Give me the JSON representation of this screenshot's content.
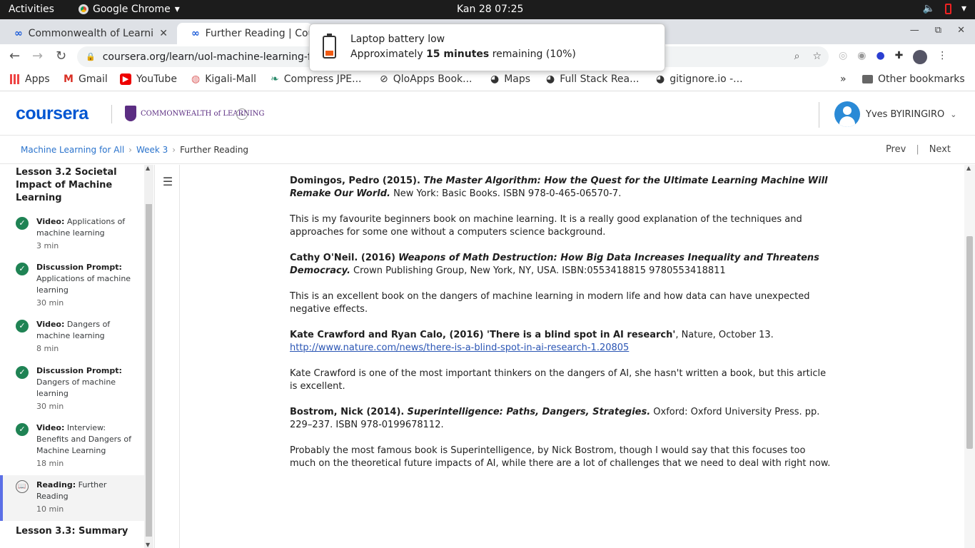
{
  "system": {
    "activities": "Activities",
    "app_name": "Google Chrome",
    "clock": "Kan 28  07:25"
  },
  "tabs": [
    {
      "title": "Commonwealth of Learni"
    },
    {
      "title": "Further Reading | Cou"
    }
  ],
  "address": {
    "url": "coursera.org/learn/uol-machine-learning-for-al"
  },
  "bookmarks": [
    {
      "label": "Apps"
    },
    {
      "label": "Gmail"
    },
    {
      "label": "YouTube"
    },
    {
      "label": "Kigali-Mall"
    },
    {
      "label": "Compress JPE..."
    },
    {
      "label": "QloApps Book..."
    },
    {
      "label": "Maps"
    },
    {
      "label": "Full Stack Rea..."
    },
    {
      "label": "gitignore.io -..."
    },
    {
      "label": "»"
    },
    {
      "label": "Other bookmarks"
    }
  ],
  "notification": {
    "title": "Laptop battery low",
    "prefix": "Approximately ",
    "bold": "15 minutes",
    "suffix": " remaining (10%)",
    "battery_level": 0.1
  },
  "header": {
    "logo": "coursera",
    "partner": "COMMONWEALTH of LEARNING",
    "user": "Yves BYIRINGIRO"
  },
  "breadcrumb": {
    "items": [
      "Machine Learning for All",
      "Week 3"
    ],
    "current": "Further Reading",
    "prev": "Prev",
    "sep": "|",
    "next": "Next"
  },
  "sidebar": {
    "lesson_title": "Lesson 3.2 Societal Impact of Machine Learning",
    "items": [
      {
        "type": "Video:",
        "title": " Applications of machine learning",
        "dur": "3 min"
      },
      {
        "type": "Discussion Prompt:",
        "title": " Applications of machine learning",
        "dur": "30 min"
      },
      {
        "type": "Video:",
        "title": " Dangers of machine learning",
        "dur": "8 min"
      },
      {
        "type": "Discussion Prompt:",
        "title": " Dangers of machine learning",
        "dur": "30 min"
      },
      {
        "type": "Video:",
        "title": " Interview: Benefits and Dangers of Machine Learning",
        "dur": "18 min"
      },
      {
        "type": "Reading:",
        "title": " Further Reading",
        "dur": "10 min"
      }
    ],
    "next_lesson": "Lesson 3.3: Summary"
  },
  "content": {
    "refs": [
      {
        "author": "Domingos, Pedro (2015).",
        "title": "The Master Algorithm: How the Quest for the Ultimate Learning Machine Will Remake Our World.",
        "rest": " New York: Basic Books. ISBN 978-0-465-06570-7."
      },
      {
        "comment": "This is my favourite beginners book on machine learning. It is a really good explanation of the techniques and approaches for some one without a computers science background."
      },
      {
        "author": "Cathy O'Neil. (2016)",
        "title": "Weapons of Math Destruction: How Big Data Increases Inequality and Threatens Democracy.",
        "rest": " Crown Publishing Group, New York, NY, USA. ISBN:0553418815 9780553418811"
      },
      {
        "comment": "This is an excellent book on the dangers of machine learning in modern life and how data can have unexpected negative effects."
      },
      {
        "author": "Kate Crawford and Ryan Calo, (2016) 'There is a blind spot in AI research'",
        "rest": ", Nature, October 13.",
        "link": "http://www.nature.com/news/there-is-a-blind-spot-in-ai-research-1.20805"
      },
      {
        "comment": "Kate Crawford is one of the most important thinkers on the dangers of AI, she hasn't written a book, but this article is excellent."
      },
      {
        "author": "Bostrom, Nick (2014).",
        "title": "Superintelligence: Paths, Dangers, Strategies.",
        "rest": " Oxford: Oxford University Press. pp. 229–237. ISBN 978-0199678112."
      },
      {
        "comment": "Probably the most famous book is Superintelligence, by Nick Bostrom, though I would say that this focuses too much on the theoretical future impacts of AI, while there are a lot of challenges that we need to deal with right now."
      }
    ]
  }
}
